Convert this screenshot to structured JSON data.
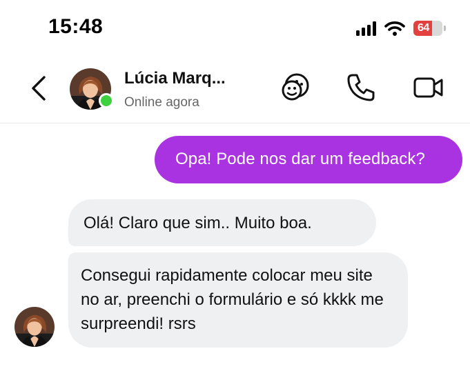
{
  "status_bar": {
    "time": "15:48",
    "battery_level": "64",
    "battery_color": "#e34040",
    "icons": [
      "signal-icon",
      "wifi-icon",
      "battery-icon"
    ]
  },
  "header": {
    "back_icon": "chevron-left-icon",
    "contact_name": "Lúcia Marq...",
    "contact_status": "Online agora",
    "online_color": "#3ed13e",
    "actions": [
      "sticker-icon",
      "phone-icon",
      "video-icon"
    ]
  },
  "messages": [
    {
      "direction": "outgoing",
      "text": "Opa! Pode nos dar um feedback?",
      "color": "#a933e0"
    },
    {
      "direction": "incoming",
      "text": "Olá! Claro que sim.. Muito boa."
    },
    {
      "direction": "incoming",
      "text": "Consegui rapidamente colocar meu site no ar, preenchi o formulário e só kkkk me surpreendi! rsrs"
    }
  ],
  "colors": {
    "incoming_bubble": "#eef0f2",
    "accent": "#a933e0"
  }
}
